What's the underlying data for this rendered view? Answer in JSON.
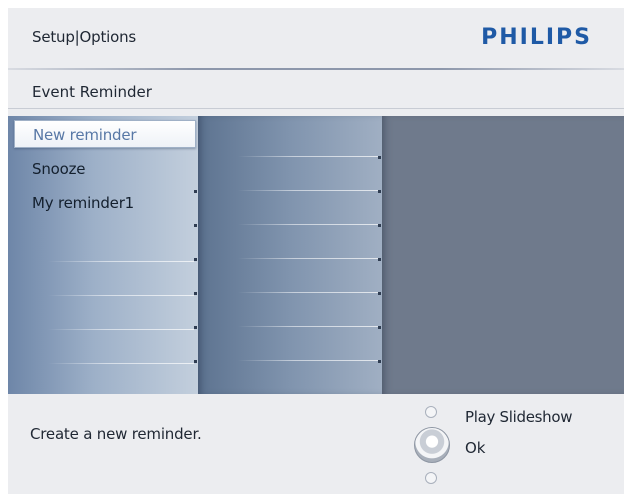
{
  "header": {
    "breadcrumb": "Setup|Options",
    "brand": "PHILIPS"
  },
  "section": {
    "title": "Event Reminder"
  },
  "menu": {
    "items": [
      {
        "label": "New reminder",
        "selected": true
      },
      {
        "label": "Snooze",
        "selected": false
      },
      {
        "label": "My reminder1",
        "selected": false
      }
    ]
  },
  "footer": {
    "help_text": "Create  a new reminder.",
    "legend_play": "Play Slideshow",
    "legend_ok": "Ok"
  },
  "colors": {
    "brand": "#1f5aa6",
    "selected_text": "#5878a6",
    "pane_dark": "#6f7a8c"
  },
  "icons": {
    "nav_up": "navigation-up-dot-icon",
    "ok": "ok-button-icon",
    "nav_down": "navigation-down-dot-icon"
  }
}
